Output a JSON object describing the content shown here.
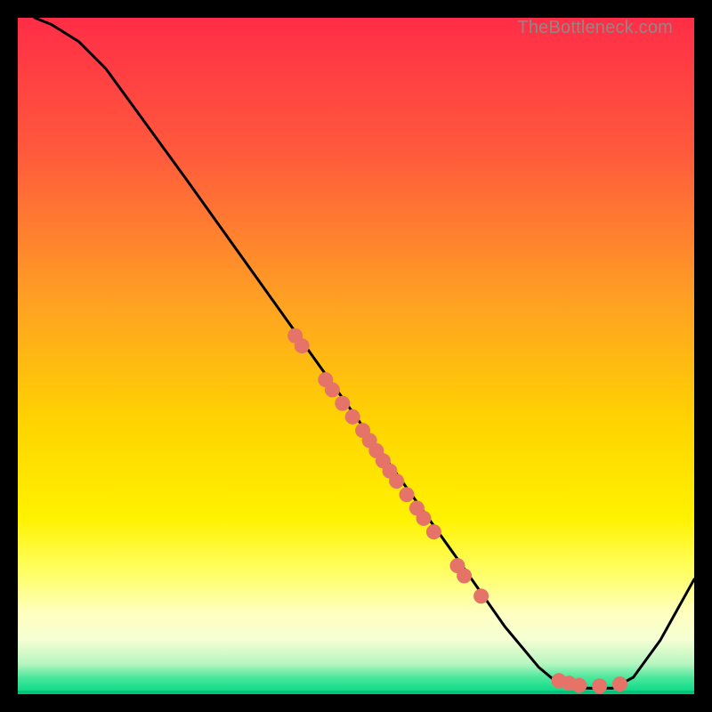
{
  "watermark": "TheBottleneck.com",
  "chart_data": {
    "type": "line",
    "title": "",
    "xlabel": "",
    "ylabel": "",
    "xlim": [
      0,
      100
    ],
    "ylim": [
      0,
      100
    ],
    "grid": false,
    "legend": false,
    "gradient_colors": {
      "top": "#ff2d47",
      "mid_upper": "#ffa123",
      "mid": "#fff200",
      "mid_lower": "#fff9a0",
      "bottom": "#00d884"
    },
    "series": [
      {
        "name": "curve",
        "type": "line",
        "points": [
          {
            "x": 2.5,
            "y": 100.0
          },
          {
            "x": 5.0,
            "y": 99.0
          },
          {
            "x": 9.0,
            "y": 96.5
          },
          {
            "x": 13.0,
            "y": 92.5
          },
          {
            "x": 17.0,
            "y": 87.0
          },
          {
            "x": 25.0,
            "y": 76.0
          },
          {
            "x": 35.0,
            "y": 62.0
          },
          {
            "x": 45.0,
            "y": 48.0
          },
          {
            "x": 55.0,
            "y": 34.0
          },
          {
            "x": 65.0,
            "y": 20.0
          },
          {
            "x": 72.0,
            "y": 10.0
          },
          {
            "x": 77.0,
            "y": 4.0
          },
          {
            "x": 80.0,
            "y": 1.5
          },
          {
            "x": 84.0,
            "y": 0.9
          },
          {
            "x": 88.0,
            "y": 0.9
          },
          {
            "x": 91.0,
            "y": 2.5
          },
          {
            "x": 95.0,
            "y": 8.0
          },
          {
            "x": 100.0,
            "y": 17.0
          }
        ]
      },
      {
        "name": "points",
        "type": "scatter",
        "color": "#e57368",
        "points": [
          {
            "x": 41.0,
            "y": 53.0
          },
          {
            "x": 42.0,
            "y": 51.5
          },
          {
            "x": 45.5,
            "y": 46.5
          },
          {
            "x": 46.5,
            "y": 45.0
          },
          {
            "x": 48.0,
            "y": 43.0
          },
          {
            "x": 49.5,
            "y": 41.0
          },
          {
            "x": 51.0,
            "y": 39.0
          },
          {
            "x": 52.0,
            "y": 37.5
          },
          {
            "x": 53.0,
            "y": 36.0
          },
          {
            "x": 54.0,
            "y": 34.5
          },
          {
            "x": 55.0,
            "y": 33.0
          },
          {
            "x": 56.0,
            "y": 31.5
          },
          {
            "x": 57.5,
            "y": 29.5
          },
          {
            "x": 59.0,
            "y": 27.5
          },
          {
            "x": 60.0,
            "y": 26.0
          },
          {
            "x": 61.5,
            "y": 24.0
          },
          {
            "x": 65.0,
            "y": 19.0
          },
          {
            "x": 66.0,
            "y": 17.5
          },
          {
            "x": 68.5,
            "y": 14.5
          },
          {
            "x": 80.0,
            "y": 2.0
          },
          {
            "x": 81.5,
            "y": 1.6
          },
          {
            "x": 83.0,
            "y": 1.3
          },
          {
            "x": 86.0,
            "y": 1.2
          },
          {
            "x": 89.0,
            "y": 1.5
          }
        ]
      }
    ]
  }
}
